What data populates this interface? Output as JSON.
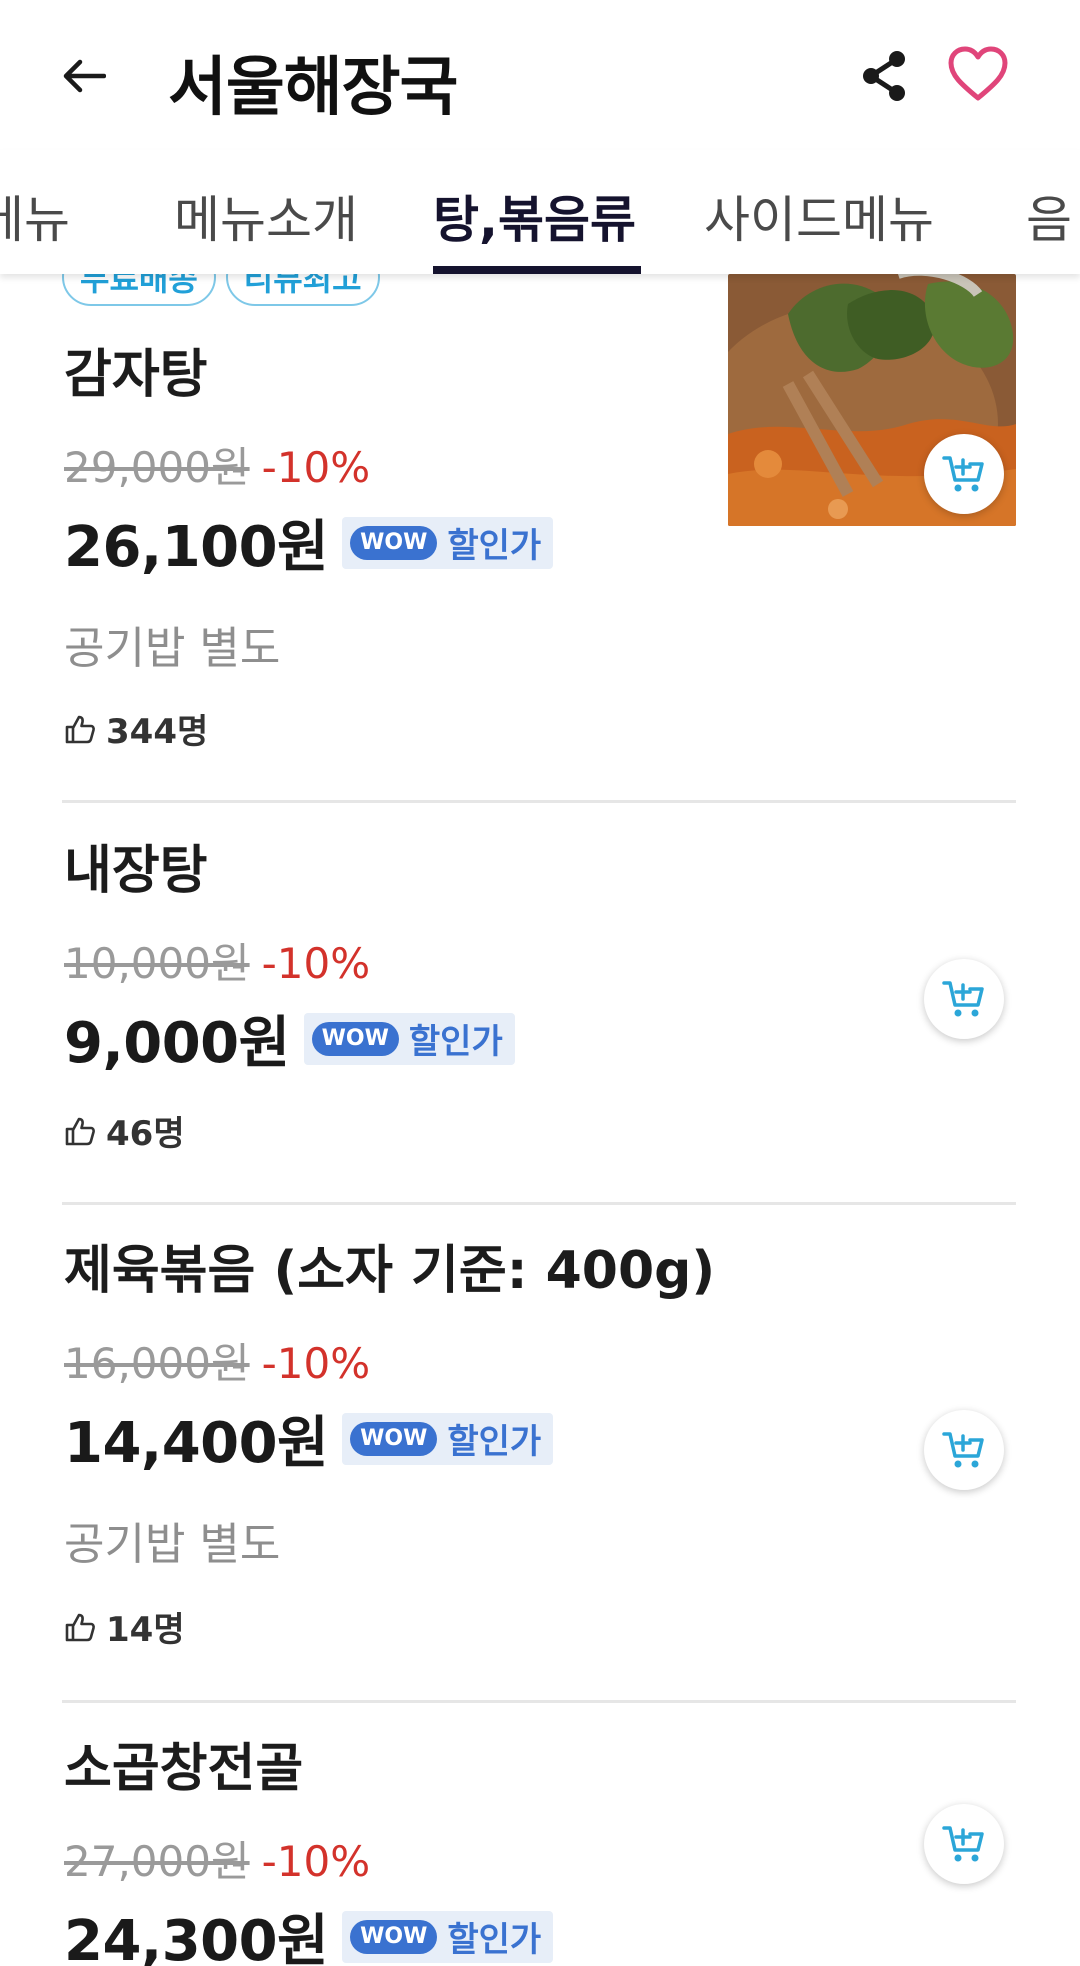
{
  "header": {
    "title": "서울해장국",
    "back_icon": "arrow-left-icon",
    "share_icon": "share-icon",
    "favorite_icon": "heart-outline-icon"
  },
  "tabs": [
    {
      "label": "인기메뉴",
      "visible_label": "메뉴",
      "active": false
    },
    {
      "label": "메뉴소개",
      "active": false
    },
    {
      "label": "탕,볶음류",
      "active": true
    },
    {
      "label": "사이드메뉴",
      "active": false
    },
    {
      "label": "음",
      "active": false
    }
  ],
  "colors": {
    "active_tab": "#15132e",
    "discount": "#d3322b",
    "wow": "#3a72d0",
    "badge": "#21a0d8",
    "heart": "#e0457a",
    "cart": "#2ba6d8"
  },
  "items": [
    {
      "badges": [
        "무료배송",
        "리뷰최고"
      ],
      "name": "감자탕",
      "original_price": "29,000원",
      "discount": "-10%",
      "price": "26,100원",
      "wow_badge": "WOW",
      "wow_label": "할인가",
      "note": "공기밥 별도",
      "likes": "344명",
      "has_image": true
    },
    {
      "name": "내장탕",
      "original_price": "10,000원",
      "discount": "-10%",
      "price": "9,000원",
      "wow_badge": "WOW",
      "wow_label": "할인가",
      "likes": "46명"
    },
    {
      "name": "제육볶음 (소자 기준: 400g)",
      "original_price": "16,000원",
      "discount": "-10%",
      "price": "14,400원",
      "wow_badge": "WOW",
      "wow_label": "할인가",
      "note": "공기밥 별도",
      "likes": "14명"
    },
    {
      "name": "소곱창전골",
      "original_price": "27,000원",
      "discount": "-10%",
      "price": "24,300원",
      "wow_badge": "WOW",
      "wow_label": "할인가"
    }
  ]
}
